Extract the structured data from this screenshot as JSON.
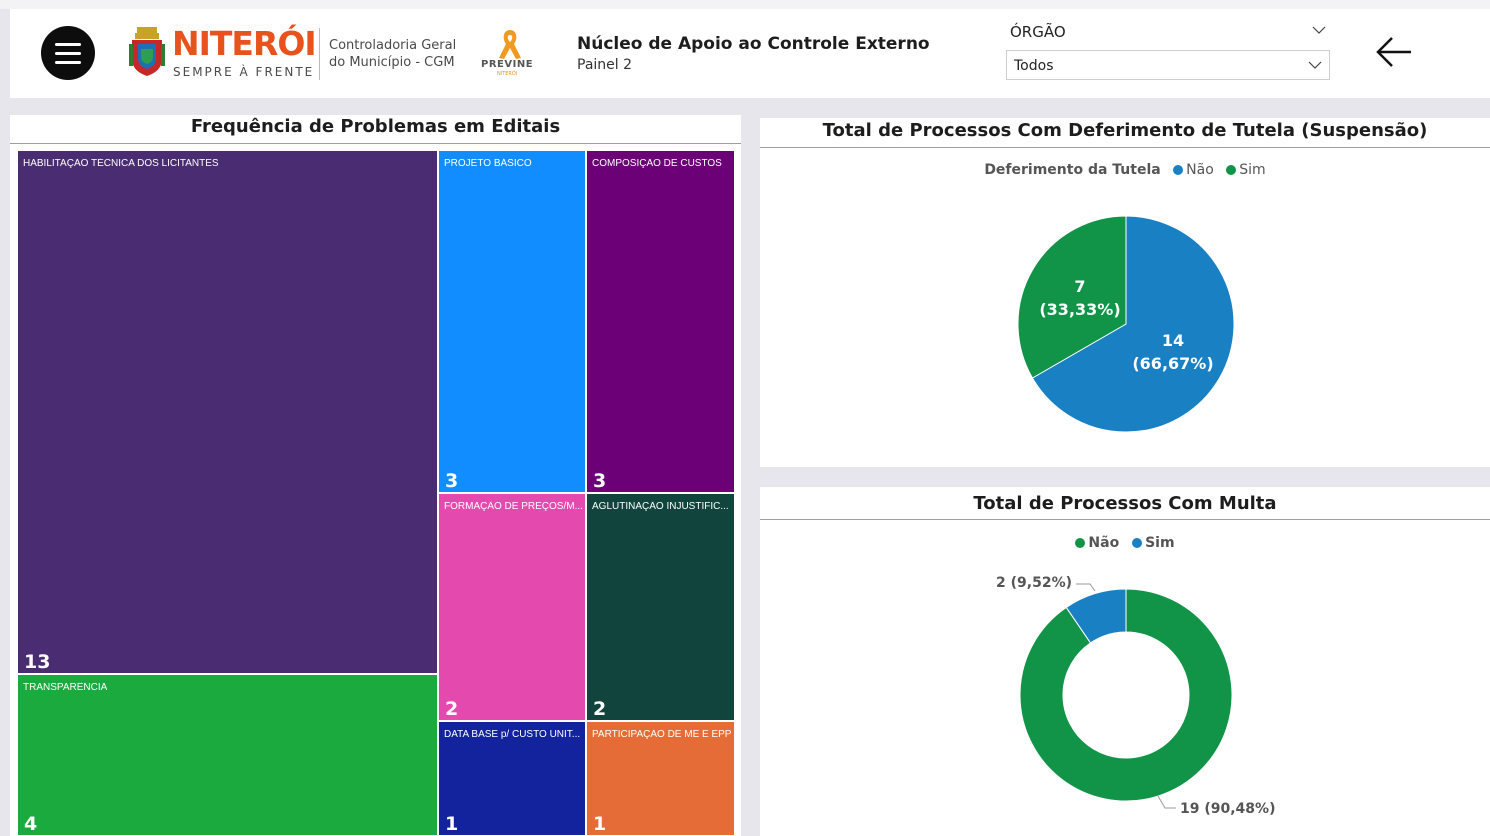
{
  "header": {
    "logo_word": "NITERÓI",
    "logo_tagline": "SEMPRE À FRENTE",
    "cgm_line1": "Controladoria Geral",
    "cgm_line2": "do Município - CGM",
    "previne": "PREVINE",
    "previne_sub": "NITERÓI",
    "title": "Núcleo de Apoio ao Controle Externo",
    "subtitle": "Painel 2",
    "filter_label": "ÓRGÃO",
    "filter_value": "Todos",
    "icons": [
      "hamburger-menu-icon",
      "chevron-down-icon",
      "arrow-left-icon"
    ]
  },
  "treemap": {
    "title": "Frequência de Problemas em Editais",
    "items": [
      {
        "label": "HABILITAÇÃO TÉCNICA DOS LICITANTES",
        "value": "13",
        "color": "#4a2c73"
      },
      {
        "label": "TRANSPARÊNCIA",
        "value": "4",
        "color": "#1aaa3e"
      },
      {
        "label": "PROJETO BÁSICO",
        "value": "3",
        "color": "#118dff"
      },
      {
        "label": "COMPOSIÇÃO DE CUSTOS",
        "value": "3",
        "color": "#6b0077"
      },
      {
        "label": "FORMAÇÃO DE PREÇOS/M...",
        "value": "2",
        "color": "#e44aae"
      },
      {
        "label": "AGLUTINAÇÃO INJUSTIFIC...",
        "value": "2",
        "color": "#12443e"
      },
      {
        "label": "DATA BASE p/ CUSTO UNIT...",
        "value": "1",
        "color": "#12239d"
      },
      {
        "label": "PARTICIPAÇÃO DE ME E EPP",
        "value": "1",
        "color": "#e66c37"
      }
    ]
  },
  "pie": {
    "title": "Total de Processos Com Deferimento de Tutela (Suspensão)",
    "legend_title": "Deferimento da Tutela",
    "legend": [
      {
        "label": "Não",
        "color": "#1a80c4"
      },
      {
        "label": "Sim",
        "color": "#119447"
      }
    ],
    "label_nao_value": "14",
    "label_nao_pct": "(66,67%)",
    "label_sim_value": "7",
    "label_sim_pct": "(33,33%)"
  },
  "donut": {
    "title": "Total de Processos Com Multa",
    "legend": [
      {
        "label": "Não",
        "color": "#119447"
      },
      {
        "label": "Sim",
        "color": "#1a80c4"
      }
    ],
    "label_sim": "2 (9,52%)",
    "label_nao": "19 (90,48%)"
  },
  "chart_data": [
    {
      "type": "treemap",
      "title": "Frequência de Problemas em Editais",
      "categories": [
        "HABILITAÇÃO TÉCNICA DOS LICITANTES",
        "TRANSPARÊNCIA",
        "PROJETO BÁSICO",
        "COMPOSIÇÃO DE CUSTOS",
        "FORMAÇÃO DE PREÇOS/M...",
        "AGLUTINAÇÃO INJUSTIFIC...",
        "DATA BASE p/ CUSTO UNIT...",
        "PARTICIPAÇÃO DE ME E EPP"
      ],
      "values": [
        13,
        4,
        3,
        3,
        2,
        2,
        1,
        1
      ]
    },
    {
      "type": "pie",
      "title": "Total de Processos Com Deferimento de Tutela (Suspensão)",
      "legend_title": "Deferimento da Tutela",
      "categories": [
        "Não",
        "Sim"
      ],
      "values": [
        14,
        7
      ],
      "percentages": [
        66.67,
        33.33
      ],
      "colors": [
        "#1a80c4",
        "#119447"
      ],
      "legend_position": "top"
    },
    {
      "type": "pie",
      "variant": "donut",
      "title": "Total de Processos Com Multa",
      "categories": [
        "Não",
        "Sim"
      ],
      "values": [
        19,
        2
      ],
      "percentages": [
        90.48,
        9.52
      ],
      "colors": [
        "#119447",
        "#1a80c4"
      ],
      "legend_position": "top"
    }
  ]
}
